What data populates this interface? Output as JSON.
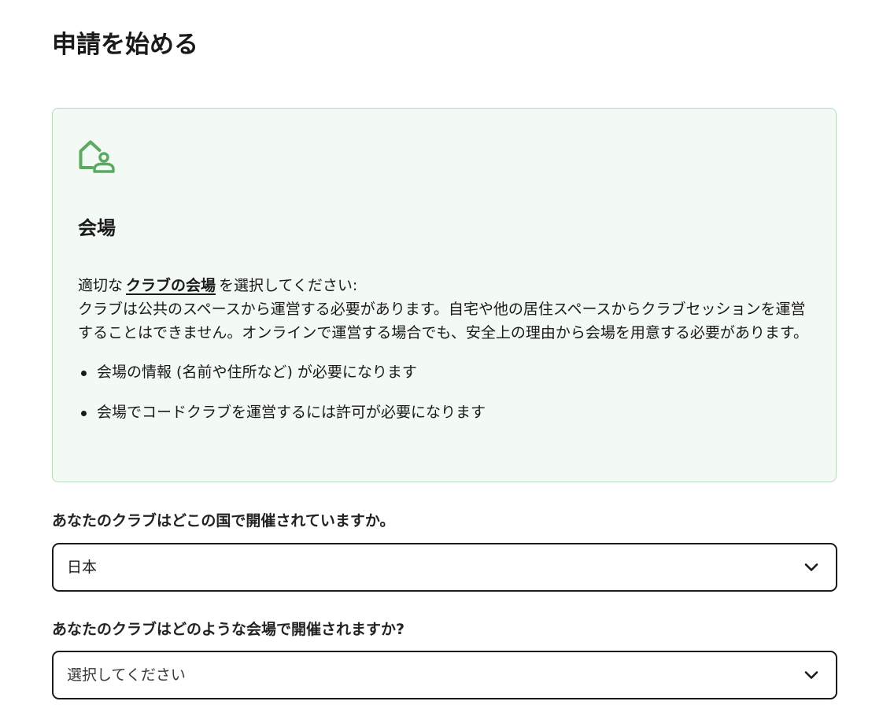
{
  "page": {
    "title": "申請を始める"
  },
  "venue_card": {
    "icon": "house-person-icon",
    "heading": "会場",
    "intro_prefix": "適切な",
    "intro_link": "クラブの会場",
    "intro_suffix": "を選択してください:",
    "description": "クラブは公共のスペースから運営する必要があります。自宅や他の居住スペースからクラブセッションを運営することはできません。オンラインで運営する場合でも、安全上の理由から会場を用意する必要があります。",
    "bullets": [
      "会場の情報 (名前や住所など) が必要になります",
      "会場でコードクラブを運営するには許可が必要になります"
    ],
    "accent_color": "#5aaa5f",
    "background_color": "#f3f9f4"
  },
  "country_field": {
    "label": "あなたのクラブはどこの国で開催されていますか。",
    "value": "日本"
  },
  "venue_type_field": {
    "label": "あなたのクラブはどのような会場で開催されますか?",
    "placeholder": "選択してください"
  }
}
